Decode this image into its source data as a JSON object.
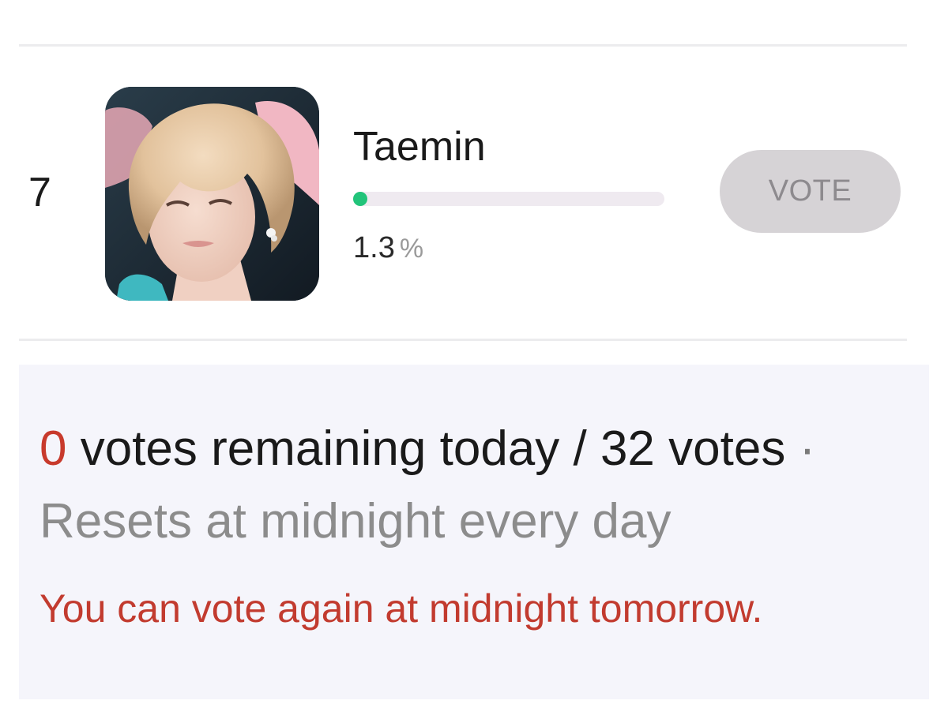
{
  "entry": {
    "rank": "7",
    "name": "Taemin",
    "progress_percent": 1.3,
    "percent_value": "1.3",
    "percent_unit": "%",
    "vote_button_label": "VOTE"
  },
  "info": {
    "remaining_count": "0",
    "remaining_text": "votes remaining today / 32 votes",
    "separator": "·",
    "reset_text": "Resets at midnight every day",
    "notice": "You can vote again at midnight tomorrow."
  },
  "colors": {
    "accent_green": "#22c47a",
    "alert_red": "#c83a2c",
    "button_disabled_bg": "#d6d3d6",
    "panel_bg": "#f5f5fb"
  },
  "icons": {
    "avatar": "artist-photo"
  }
}
